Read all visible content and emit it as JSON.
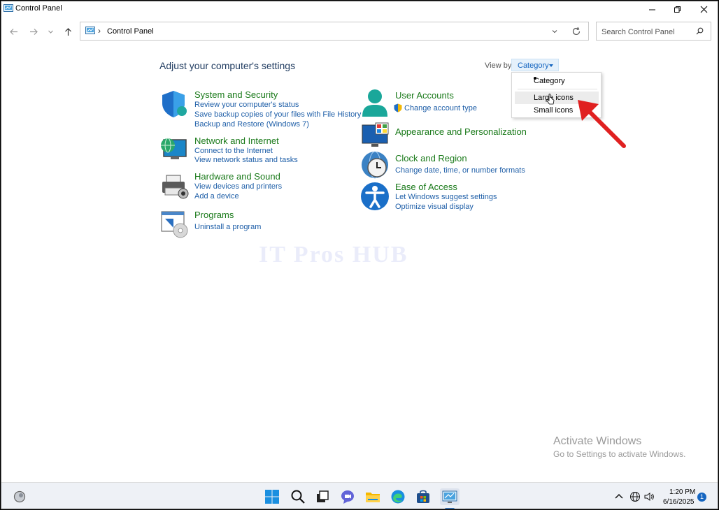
{
  "window": {
    "title": "Control Panel"
  },
  "address": {
    "path": "Control Panel",
    "separator": "›"
  },
  "search": {
    "placeholder": "Search Control Panel"
  },
  "heading": "Adjust your computer's settings",
  "view_by": {
    "label": "View by:",
    "selected": "Category"
  },
  "view_menu": {
    "items": [
      "Category",
      "Large icons",
      "Small icons"
    ],
    "checked": "Category",
    "hovered": "Large icons"
  },
  "categories_left": [
    {
      "title": "System and Security",
      "links": [
        "Review your computer's status",
        "Save backup copies of your files with File History",
        "Backup and Restore (Windows 7)"
      ]
    },
    {
      "title": "Network and Internet",
      "links": [
        "Connect to the Internet",
        "View network status and tasks"
      ]
    },
    {
      "title": "Hardware and Sound",
      "links": [
        "View devices and printers",
        "Add a device"
      ]
    },
    {
      "title": "Programs",
      "links": [
        "Uninstall a program"
      ]
    }
  ],
  "categories_right": [
    {
      "title": "User Accounts",
      "links": [
        "Change account type"
      ]
    },
    {
      "title": "Appearance and Personalization",
      "links": []
    },
    {
      "title": "Clock and Region",
      "links": [
        "Change date, time, or number formats"
      ]
    },
    {
      "title": "Ease of Access",
      "links": [
        "Let Windows suggest settings",
        "Optimize visual display"
      ]
    }
  ],
  "watermark": "IT Pros HUB",
  "activation": {
    "line1": "Activate Windows",
    "line2": "Go to Settings to activate Windows."
  },
  "taskbar": {
    "time": "1:20 PM",
    "date": "6/16/2025",
    "notification_count": "1"
  },
  "colors": {
    "accent": "#1565c0",
    "category_title": "#1a7a1a",
    "link": "#1f5fa8",
    "arrow": "#e02020"
  }
}
